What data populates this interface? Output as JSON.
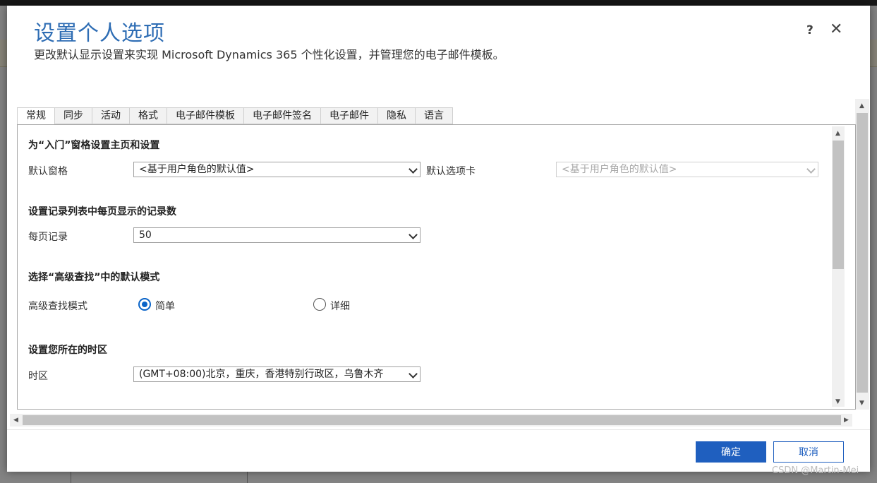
{
  "dialog": {
    "title": "设置个人选项",
    "subtitle": "更改默认显示设置来实现 Microsoft Dynamics 365 个性化设置，并管理您的电子邮件模板。",
    "help_label": "?",
    "close_label": "✕"
  },
  "tabs": [
    {
      "label": "常规",
      "active": true
    },
    {
      "label": "同步"
    },
    {
      "label": "活动"
    },
    {
      "label": "格式"
    },
    {
      "label": "电子邮件模板"
    },
    {
      "label": "电子邮件签名"
    },
    {
      "label": "电子邮件"
    },
    {
      "label": "隐私"
    },
    {
      "label": "语言"
    }
  ],
  "general": {
    "start_pane": {
      "title": "为“入门”窗格设置主页和设置",
      "default_pane_label": "默认窗格",
      "default_pane_value": "<基于用户角色的默认值>",
      "default_tab_label": "默认选项卡",
      "default_tab_value": "<基于用户角色的默认值>"
    },
    "records_per_page": {
      "title": "设置记录列表中每页显示的记录数",
      "label": "每页记录",
      "value": "50"
    },
    "advanced_find": {
      "title": "选择“高级查找”中的默认模式",
      "label": "高级查找模式",
      "options": [
        {
          "label": "简单",
          "checked": true
        },
        {
          "label": "详细",
          "checked": false
        }
      ]
    },
    "time_zone": {
      "title": "设置您所在的时区",
      "label": "时区",
      "value": "(GMT+08:00)北京，重庆，香港特别行政区，乌鲁木齐"
    }
  },
  "footer": {
    "ok_label": "确定",
    "cancel_label": "取消"
  },
  "watermark": "CSDN @Martin-Mei",
  "colors": {
    "accent": "#1f5fbf",
    "title": "#2e6db4",
    "radio": "#0a64c8"
  }
}
